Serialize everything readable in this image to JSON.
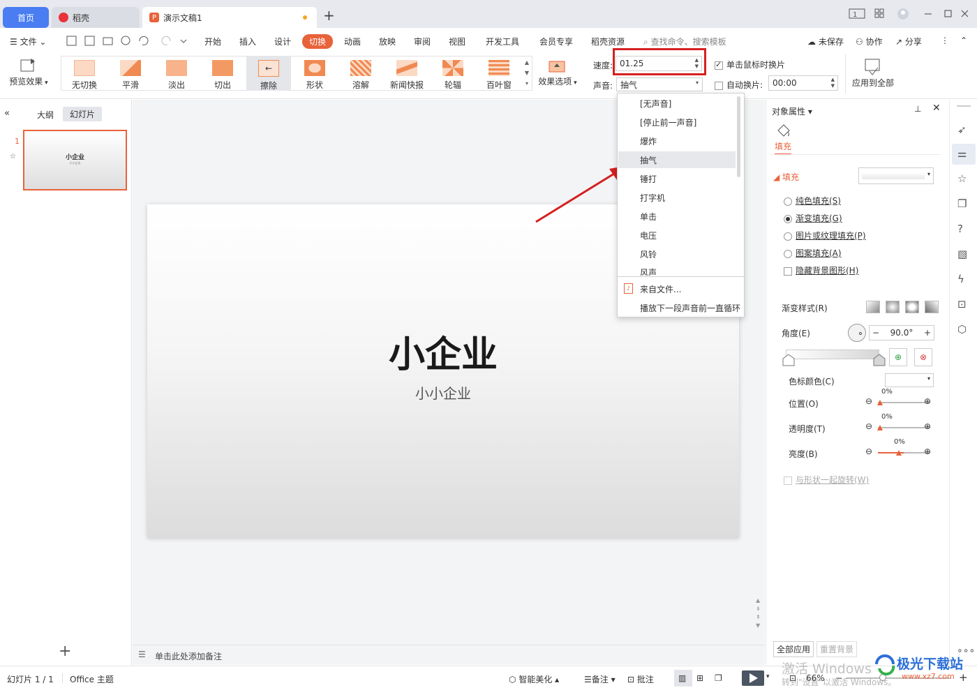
{
  "tabs": {
    "home": "首页",
    "daoke": "稻壳",
    "doc": "演示文稿1",
    "new": "+"
  },
  "menu": {
    "file": "文件",
    "items": [
      "开始",
      "插入",
      "设计",
      "切换",
      "动画",
      "放映",
      "审阅",
      "视图",
      "开发工具",
      "会员专享",
      "稻壳资源"
    ],
    "search_placeholder": "查找命令、搜索模板",
    "unsaved": "未保存",
    "collab": "协作",
    "share": "分享"
  },
  "ribbon": {
    "preview": "预览效果",
    "transitions": [
      "无切换",
      "平滑",
      "淡出",
      "切出",
      "擦除",
      "形状",
      "溶解",
      "新闻快报",
      "轮辐",
      "百叶窗"
    ],
    "selected_transition": "擦除",
    "effect_options": "效果选项",
    "speed_label": "速度:",
    "speed_value": "01.25",
    "sound_label": "声音:",
    "sound_value": "抽气",
    "on_click_label": "单击鼠标时换片",
    "on_click_checked": true,
    "auto_label": "自动换片:",
    "auto_checked": false,
    "auto_value": "00:00",
    "apply_all": "应用到全部"
  },
  "sound_dropdown": {
    "items": [
      "[无声音]",
      "[停止前一声音]",
      "爆炸",
      "抽气",
      "锤打",
      "打字机",
      "单击",
      "电压",
      "风铃",
      "风声"
    ],
    "highlighted": "抽气",
    "from_file": "来自文件...",
    "loop": "播放下一段声音前一直循环"
  },
  "left_panel": {
    "tab_outline": "大纲",
    "tab_slides": "幻灯片",
    "slide_number": "1",
    "thumb_title": "小企业",
    "thumb_subtitle": "小小企业",
    "add": "+"
  },
  "slide": {
    "title": "小企业",
    "subtitle": "小小企业"
  },
  "notes": {
    "placeholder": "单击此处添加备注"
  },
  "right_panel": {
    "title": "对象属性",
    "tab_fill": "填充",
    "section_fill": "填充",
    "options": [
      "纯色填充(S)",
      "渐变填充(G)",
      "图片或纹理填充(P)",
      "图案填充(A)"
    ],
    "selected_option": "渐变填充(G)",
    "hide_bg": "隐藏背景图形(H)",
    "gradient_style": "渐变样式(R)",
    "angle_label": "角度(E)",
    "angle_value": "90.0°",
    "stop_color": "色标颜色(C)",
    "position_label": "位置(O)",
    "position_value": "0%",
    "transparency_label": "透明度(T)",
    "transparency_value": "0%",
    "brightness_label": "亮度(B)",
    "brightness_value": "0%",
    "rotate_with_shape": "与形状一起旋转(W)",
    "apply_all": "全部应用",
    "reset_bg": "重置背景"
  },
  "statusbar": {
    "slide_info": "幻灯片 1 / 1",
    "theme": "Office 主题",
    "beautify": "智能美化",
    "notes": "备注",
    "comment": "批注",
    "zoom": "66%"
  },
  "watermark": {
    "activate_line1": "激活 Windows",
    "activate_line2": "转到\"设置\"以激活 Windows。",
    "site": "极光下载站",
    "site_url": "www.xz7.com"
  },
  "colors": {
    "accent": "#e8623a",
    "highlight": "#d61f1f",
    "tab_blue": "#4a7df2"
  }
}
